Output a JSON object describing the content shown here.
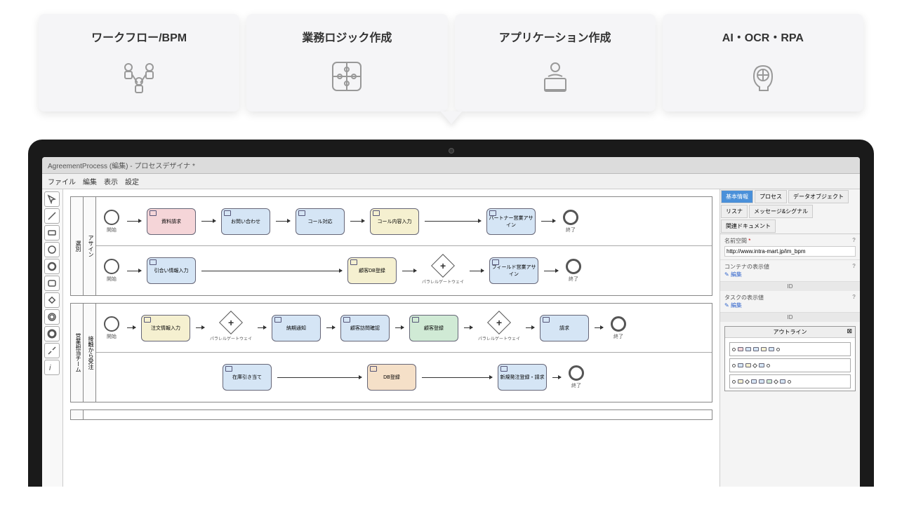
{
  "cards": [
    {
      "title": "ワークフロー/BPM"
    },
    {
      "title": "業務ロジック作成"
    },
    {
      "title": "アプリケーション作成"
    },
    {
      "title": "AI・OCR・RPA"
    }
  ],
  "window": {
    "title": "AgreementProcess (編集) - プロセスデザイナ *"
  },
  "menu": {
    "file": "ファイル",
    "edit": "編集",
    "view": "表示",
    "settings": "設定"
  },
  "pools": [
    {
      "label": "選別",
      "lanes": [
        {
          "label": "アサイン",
          "start": "開始",
          "tasks": [
            {
              "label": "資料請求",
              "color": "pink"
            },
            {
              "label": "お問い合わせ",
              "color": "blue"
            },
            {
              "label": "コール対応",
              "color": "blue"
            },
            {
              "label": "コール内容入力",
              "color": "yellow"
            },
            {
              "label": "パートナー営業アサイン",
              "color": "blue"
            }
          ],
          "end": "終了"
        },
        {
          "label": "",
          "start": "開始",
          "tasks": [
            {
              "label": "引合い情報入力",
              "color": "blue"
            },
            {
              "label": "顧客DB登録",
              "color": "yellow"
            },
            {
              "label": "フィールド営業アサイン",
              "color": "blue"
            }
          ],
          "gateway": "パラレルゲートウェイ",
          "end": "終了"
        }
      ]
    },
    {
      "label": "営業担当チーム",
      "lanes": [
        {
          "label": "接触から受注",
          "start": "開始",
          "tasks": [
            {
              "label": "注文情報入力",
              "color": "yellow"
            },
            {
              "label": "納期通知",
              "color": "blue"
            },
            {
              "label": "顧客訪問確認",
              "color": "blue"
            },
            {
              "label": "顧客登録",
              "color": "green"
            },
            {
              "label": "請求",
              "color": "blue"
            }
          ],
          "gateway1": "パラレルゲートウェイ",
          "gateway2": "パラレルゲートウェイ",
          "end": "終了",
          "tasks2": [
            {
              "label": "在庫引き当て",
              "color": "blue"
            },
            {
              "label": "DB登録",
              "color": "orange"
            },
            {
              "label": "新規発注登録・請求",
              "color": "blue"
            }
          ],
          "end2": "終了"
        }
      ]
    }
  ],
  "panel": {
    "tabs": {
      "basic": "基本情報",
      "process": "プロセス",
      "dataobj": "データオブジェクト",
      "listener": "リスナ",
      "msgsignal": "メッセージ&シグナル",
      "reldoc": "関連ドキュメント"
    },
    "namespace": {
      "label": "名前空間",
      "value": "http://www.intra-mart.jp/im_bpm"
    },
    "container": {
      "label": "コンテナの表示値",
      "edit": "編集",
      "id": "ID"
    },
    "taskdisp": {
      "label": "タスクの表示値",
      "edit": "編集",
      "id": "ID"
    }
  },
  "outline": {
    "title": "アウトライン"
  }
}
